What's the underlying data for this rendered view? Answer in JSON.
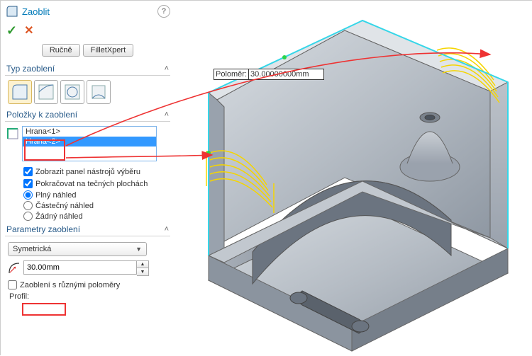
{
  "header": {
    "title": "Zaoblit"
  },
  "tabs": {
    "manual": "Ručně",
    "xpert": "FilletXpert"
  },
  "sections": {
    "type": "Typ zaoblení",
    "items": "Položky k zaoblení",
    "params": "Parametry zaoblení"
  },
  "listbox": {
    "items": [
      "Hrana<1>",
      "Hrana<2>"
    ]
  },
  "options": {
    "show_toolbar": "Zobrazit panel nástrojů výběru",
    "tangent": "Pokračovat na tečných plochách",
    "full_preview": "Plný náhled",
    "partial_preview": "Částečný náhled",
    "no_preview": "Žádný náhled"
  },
  "params": {
    "symmetry_select": "Symetrická",
    "radius_value": "30.00mm",
    "vary_radius": "Zaoblení s různými poloměry",
    "profile_label": "Profil:"
  },
  "tooltip": {
    "label": "Poloměr:",
    "value": "30.00000000mm"
  },
  "icons": {
    "help": "?",
    "check": "✓",
    "cross": "✕",
    "chevron_up": "˄",
    "caret_down": "▼",
    "spin_up": "▲",
    "spin_down": "▼"
  }
}
